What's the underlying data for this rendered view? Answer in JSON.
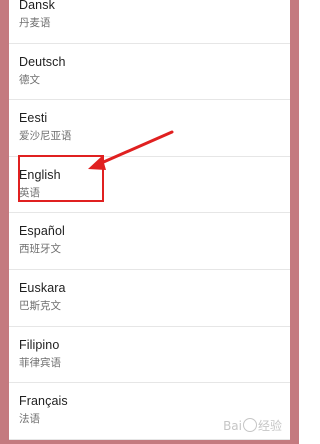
{
  "languages": [
    {
      "name": "Dansk",
      "native": "丹麦语"
    },
    {
      "name": "Deutsch",
      "native": "德文"
    },
    {
      "name": "Eesti",
      "native": "爱沙尼亚语"
    },
    {
      "name": "English",
      "native": "英语"
    },
    {
      "name": "Español",
      "native": "西班牙文"
    },
    {
      "name": "Euskara",
      "native": "巴斯克文"
    },
    {
      "name": "Filipino",
      "native": "菲律宾语"
    },
    {
      "name": "Français",
      "native": "法语"
    }
  ],
  "annotation": {
    "highlight_color": "#e02020",
    "highlighted_item": "English"
  },
  "watermark": {
    "text_left": "Bai",
    "text_right": "经验"
  },
  "colors": {
    "frame": "#c47a7f",
    "text_primary": "#1e1e1e",
    "text_secondary": "#6f6f6f"
  }
}
